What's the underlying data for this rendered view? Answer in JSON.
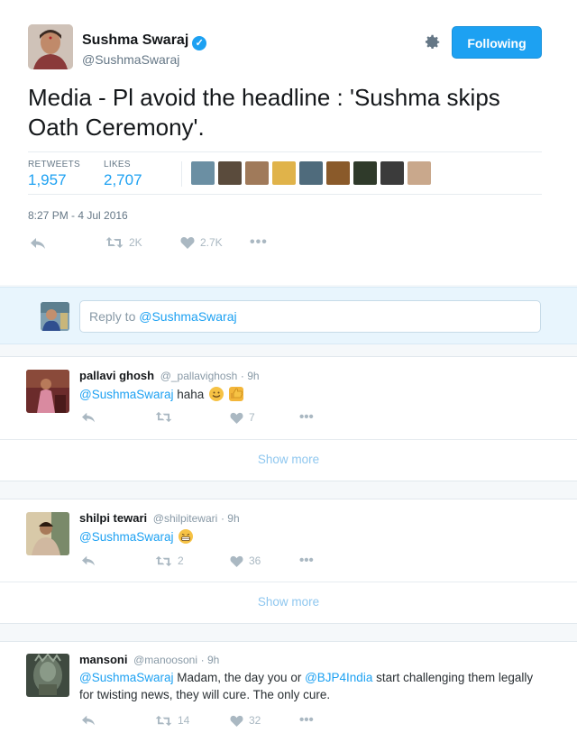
{
  "tweet": {
    "author_name": "Sushma Swaraj",
    "author_handle": "@SushmaSwaraj",
    "follow_label": "Following",
    "text": "Media - Pl avoid the headline : 'Sushma skips Oath Ceremony'.",
    "retweets_label": "RETWEETS",
    "retweets_count": "1,957",
    "likes_label": "LIKES",
    "likes_count": "2,707",
    "timestamp": "8:27 PM - 4 Jul 2016",
    "action_retweet_count": "2K",
    "action_like_count": "2.7K",
    "liker_colors": [
      "#6b8fa3",
      "#5a4b3c",
      "#a07a5a",
      "#e0b34a",
      "#4f6b7c",
      "#8a5a2a",
      "#2f3a2a",
      "#3b3b3b",
      "#c9a88c"
    ]
  },
  "reply_box": {
    "prefix": "Reply to ",
    "handle": "@SushmaSwaraj"
  },
  "replies": [
    {
      "name": "pallavi ghosh",
      "handle": "@_pallavighosh",
      "time": "· 9h",
      "mention": "@SushmaSwaraj",
      "text": " haha",
      "retweet_count": "",
      "like_count": "7",
      "avatar_color": "#8a3b3b"
    },
    {
      "name": "shilpi tewari",
      "handle": "@shilpitewari",
      "time": "· 9h",
      "mention": "@SushmaSwaraj",
      "text": "",
      "retweet_count": "2",
      "like_count": "36",
      "avatar_color": "#b59a7a"
    },
    {
      "name": "mansoni",
      "handle": "@manoosoni",
      "time": "· 9h",
      "mention": "@SushmaSwaraj",
      "text_part1": " Madam, the day you or ",
      "mention2": "@BJP4India",
      "text_part2": " start challenging them legally for twisting news, they will cure. The only cure.",
      "retweet_count": "14",
      "like_count": "32",
      "avatar_color": "#4a5a4a"
    }
  ],
  "show_more_label": "Show more",
  "colors": {
    "accent": "#1da1f2",
    "muted": "#657786",
    "icon": "#aab8c2"
  }
}
